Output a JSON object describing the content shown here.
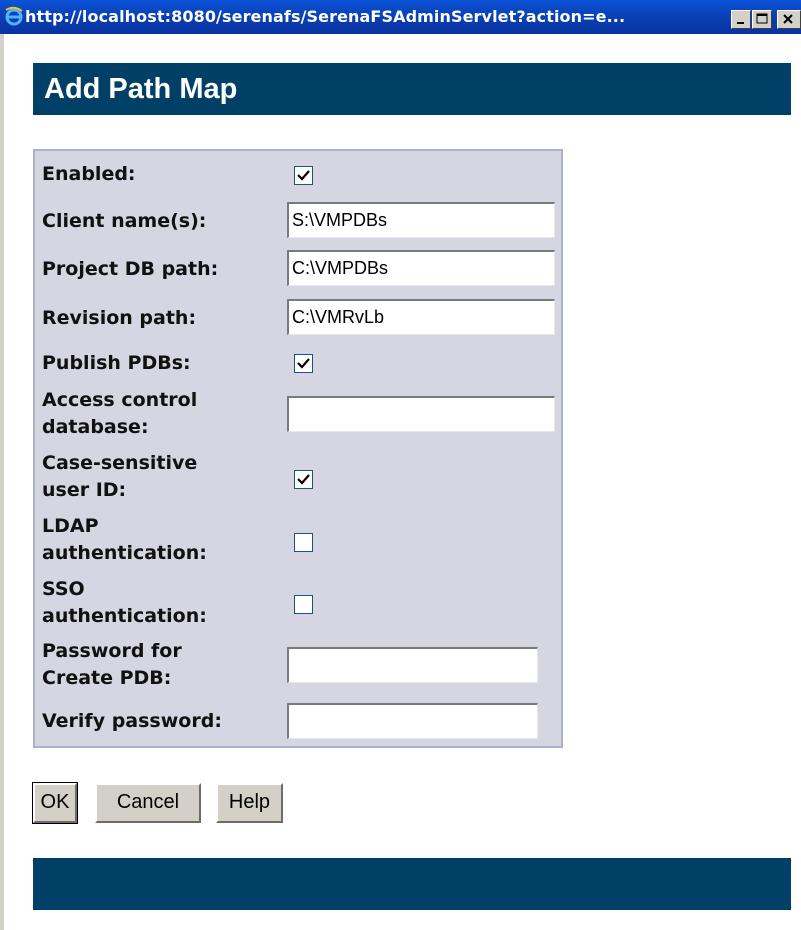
{
  "window": {
    "title": "http://localhost:8080/serenafs/SerenaFSAdminServlet?action=e...",
    "icon": "internet-explorer-icon",
    "controls": [
      "minimize-icon",
      "maximize-icon",
      "close-icon"
    ]
  },
  "header": {
    "title": "Add Path Map"
  },
  "form": {
    "enabled": {
      "label": "Enabled:",
      "checked": true
    },
    "client_names": {
      "label": "Client name(s):",
      "value": "S:\\VMPDBs"
    },
    "project_db_path": {
      "label": "Project DB path:",
      "value": "C:\\VMPDBs"
    },
    "revision_path": {
      "label": "Revision path:",
      "value": "C:\\VMRvLb"
    },
    "publish_pdbs": {
      "label": "Publish PDBs:",
      "checked": true
    },
    "access_control_db": {
      "label_line1": "Access control",
      "label_line2": "database:",
      "value": ""
    },
    "case_sensitive": {
      "label_line1": "Case-sensitive",
      "label_line2": "user ID:",
      "checked": true
    },
    "ldap_auth": {
      "label_line1": "LDAP",
      "label_line2": "authentication:",
      "checked": false
    },
    "sso_auth": {
      "label_line1": "SSO",
      "label_line2": "authentication:",
      "checked": false
    },
    "password_create_pdb": {
      "label_line1": "Password for",
      "label_line2": "Create PDB:",
      "value": ""
    },
    "verify_password": {
      "label": "Verify password:",
      "value": ""
    }
  },
  "buttons": {
    "ok": "OK",
    "cancel": "Cancel",
    "help": "Help"
  },
  "colors": {
    "header_bar": "#003f66",
    "panel_bg": "#d6d6e2",
    "titlebar": "#0a3fb4"
  }
}
